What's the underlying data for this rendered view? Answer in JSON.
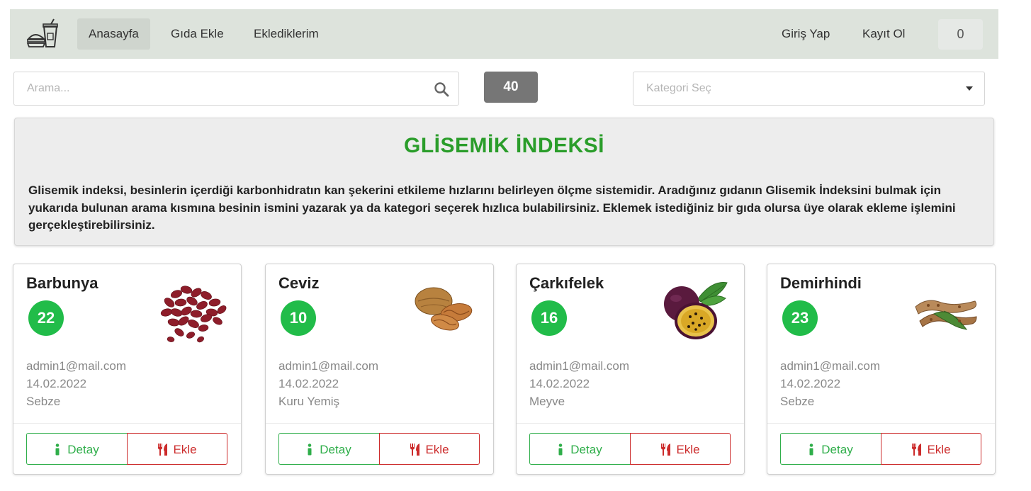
{
  "nav": {
    "items": [
      {
        "label": "Anasayfa",
        "active": true
      },
      {
        "label": "Gıda Ekle",
        "active": false
      },
      {
        "label": "Eklediklerim",
        "active": false
      }
    ],
    "login_label": "Giriş Yap",
    "register_label": "Kayıt Ol",
    "cart_count": "0"
  },
  "search": {
    "placeholder": "Arama...",
    "icon": "search-icon"
  },
  "result_count": "40",
  "category": {
    "placeholder": "Kategori Seç"
  },
  "info": {
    "title": "GLİSEMİK İNDEKSİ",
    "text": "Glisemik indeksi, besinlerin içerdiği karbonhidratın kan şekerini etkileme hızlarını belirleyen ölçme sistemidir. Aradığınız gıdanın Glisemik İndeksini bulmak için yukarıda bulunan arama kısmına besinin ismini yazarak ya da kategori seçerek hızlıca bulabilirsiniz. Eklemek istediğiniz bir gıda olursa üye olarak ekleme işlemini gerçekleştirebilirsiniz."
  },
  "colors": {
    "navbar_bg": "#dde3dc",
    "title_green": "#2a9d2a",
    "gi_badge": "#21bc49",
    "detail_green": "#2fae4a",
    "add_red": "#cc2b2b"
  },
  "cards": [
    {
      "name": "Barbunya",
      "gi": "22",
      "email": "admin1@mail.com",
      "date": "14.02.2022",
      "category": "Sebze",
      "image": "red-beans"
    },
    {
      "name": "Ceviz",
      "gi": "10",
      "email": "admin1@mail.com",
      "date": "14.02.2022",
      "category": "Kuru Yemiş",
      "image": "walnut"
    },
    {
      "name": "Çarkıfelek",
      "gi": "16",
      "email": "admin1@mail.com",
      "date": "14.02.2022",
      "category": "Meyve",
      "image": "passion-fruit"
    },
    {
      "name": "Demirhindi",
      "gi": "23",
      "email": "admin1@mail.com",
      "date": "14.02.2022",
      "category": "Sebze",
      "image": "tamarind"
    }
  ],
  "buttons": {
    "detail_label": "Detay",
    "add_label": "Ekle"
  }
}
